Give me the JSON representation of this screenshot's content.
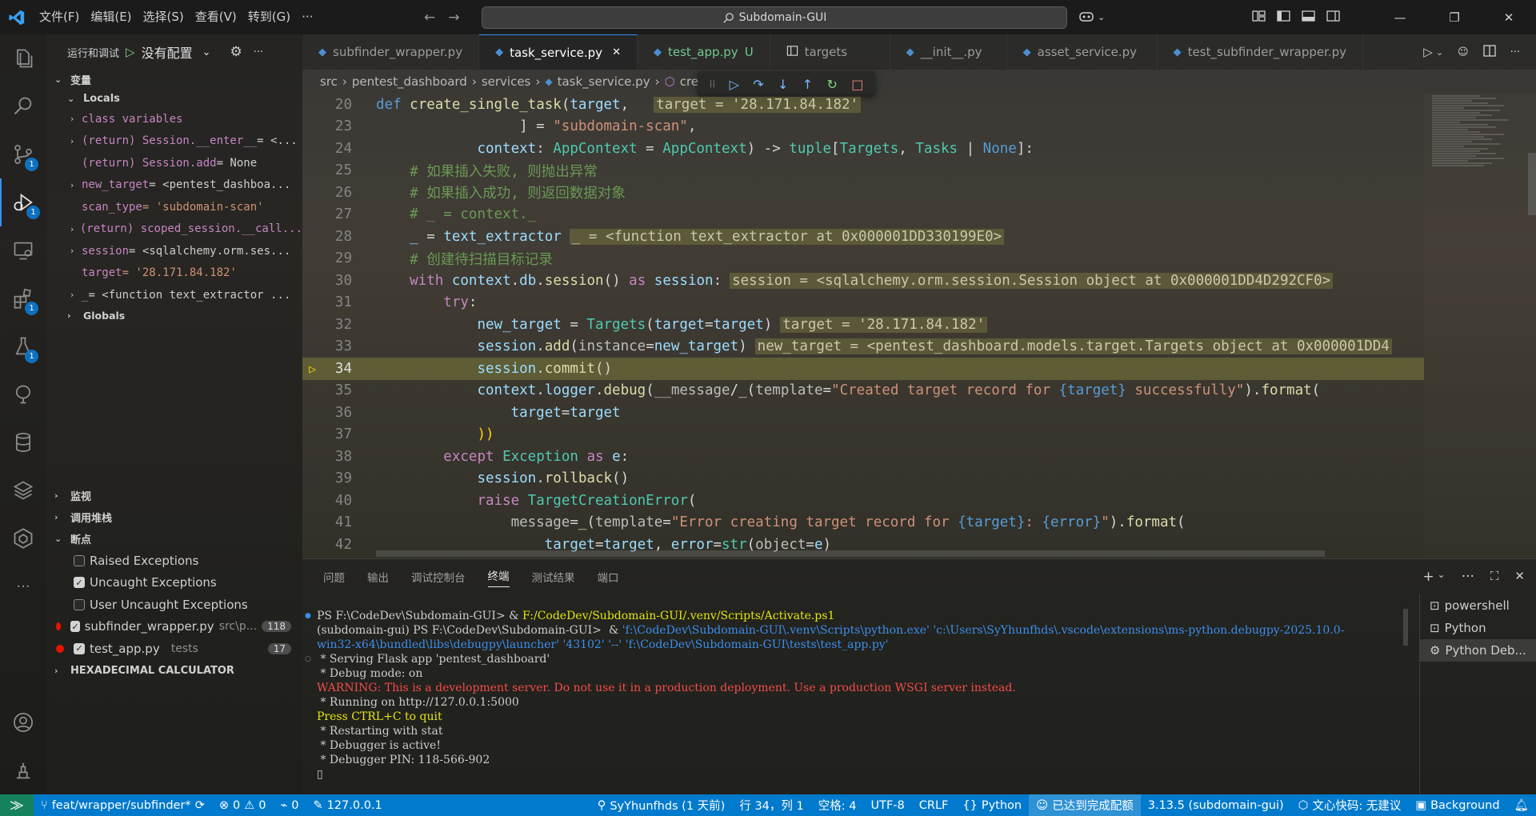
{
  "titlebar": {
    "menu": [
      "文件(F)",
      "编辑(E)",
      "选择(S)",
      "查看(V)",
      "转到(G)",
      "···"
    ],
    "search_text": "Subdomain-GUI"
  },
  "activity_badges": {
    "scm": "1",
    "debug": "1",
    "extensions": "1",
    "testing": "1"
  },
  "sidebar": {
    "header_label": "运行和调试",
    "config_select": "没有配置",
    "variables_title": "变量",
    "locals_title": "Locals",
    "globals_title": "Globals",
    "locals": [
      {
        "name": "class variables",
        "value": "",
        "expandable": true
      },
      {
        "name": "(return) Session.__enter__",
        "value": " = <...",
        "expandable": true
      },
      {
        "name": "(return) Session.add",
        "value": " = None",
        "expandable": false
      },
      {
        "name": "new_target",
        "value": " = <pentest_dashboa...",
        "expandable": true
      },
      {
        "name": "scan_type",
        "value": " = 'subdomain-scan'",
        "expandable": false
      },
      {
        "name": "(return) scoped_session.__call...",
        "value": "",
        "expandable": true
      },
      {
        "name": "session",
        "value": " = <sqlalchemy.orm.ses...",
        "expandable": true
      },
      {
        "name": "target",
        "value": " = '28.171.84.182'",
        "expandable": false
      },
      {
        "name": "_",
        "value": " = <function text_extractor ...",
        "expandable": true
      }
    ],
    "watch_title": "监视",
    "callstack_title": "调用堆栈",
    "breakpoints_title": "断点",
    "breakpoints": [
      {
        "label": "Raised Exceptions",
        "checked": false
      },
      {
        "label": "Uncaught Exceptions",
        "checked": true
      },
      {
        "label": "User Uncaught Exceptions",
        "checked": false
      }
    ],
    "bp_files": [
      {
        "file": "subfinder_wrapper.py",
        "path": "src\\p...",
        "count": "118"
      },
      {
        "file": "test_app.py",
        "path": "tests",
        "count": "17"
      }
    ],
    "hex_title": "HEXADECIMAL CALCULATOR"
  },
  "tabs": [
    {
      "label": "subfinder_wrapper.py"
    },
    {
      "label": "task_service.py"
    },
    {
      "label": "test_app.py",
      "status": "U"
    },
    {
      "label": "targets"
    },
    {
      "label": "__init__.py"
    },
    {
      "label": "asset_service.py"
    },
    {
      "label": "test_subfinder_wrapper.py"
    }
  ],
  "breadcrumb": [
    "src",
    "pentest_dashboard",
    "services",
    "task_service.py",
    "cre"
  ],
  "editor": {
    "line_numbers": [
      "20",
      "23",
      "24",
      "25",
      "26",
      "27",
      "28",
      "29",
      "30",
      "31",
      "32",
      "33",
      "34",
      "35",
      "36",
      "37",
      "38",
      "39",
      "40",
      "41",
      "42"
    ],
    "current_line": "34",
    "inline": {
      "l20": "target = '28.171.84.182'",
      "l28": "_ = <function text_extractor at 0x000001DD330199E0>",
      "l30": "session = <sqlalchemy.orm.session.Session object at 0x000001DD4D292CF0>",
      "l32": "target = '28.171.84.182'",
      "l33": "new_target = <pentest_dashboard.models.target.Targets object at 0x000001DD4"
    }
  },
  "panel": {
    "tabs": [
      "问题",
      "输出",
      "调试控制台",
      "终端",
      "测试结果",
      "端口"
    ],
    "terminal_lines": [
      "PS F:\\CodeDev\\Subdomain-GUI> & F:/CodeDev/Subdomain-GUI/.venv/Scripts/Activate.ps1",
      "(subdomain-gui) PS F:\\CodeDev\\Subdomain-GUI>  & 'f:\\CodeDev\\Subdomain-GUI\\.venv\\Scripts\\python.exe' 'c:\\Users\\SyYhunfhds\\.vscode\\extensions\\ms-python.debugpy-2025.10.0-",
      "win32-x64\\bundled\\libs\\debugpy\\launcher' '43102' '--' 'f:\\CodeDev\\Subdomain-GUI\\tests\\test_app.py'",
      " * Serving Flask app 'pentest_dashboard'",
      " * Debug mode: on",
      "WARNING: This is a development server. Do not use it in a production deployment. Use a production WSGI server instead.",
      " * Running on http://127.0.0.1:5000",
      "Press CTRL+C to quit",
      " * Restarting with stat",
      " * Debugger is active!",
      " * Debugger PIN: 118-566-902",
      "▯"
    ],
    "terminals": [
      "powershell",
      "Python",
      "Python Deb..."
    ]
  },
  "statusbar": {
    "branch": "feat/wrapper/subfinder*",
    "errors": "0",
    "warnings": "0",
    "ports": "0",
    "host": "127.0.0.1",
    "author": "SyYhunfhds (1 天前)",
    "position": "行 34，列 1",
    "spaces": "空格: 4",
    "encoding": "UTF-8",
    "eol": "CRLF",
    "language": "Python",
    "config_status": "已达到完成配额",
    "interpreter": "3.13.5 (subdomain-gui)",
    "lingma": "文心快码: 无建议",
    "background": "Background"
  }
}
